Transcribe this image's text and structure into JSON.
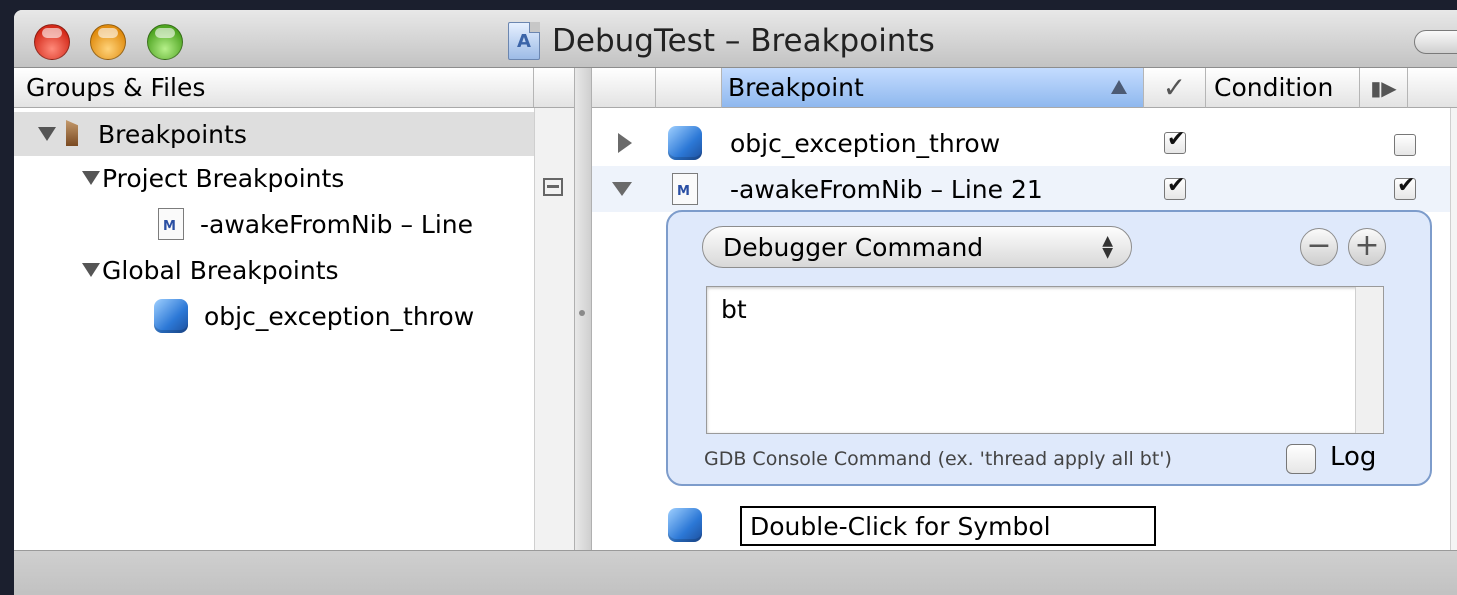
{
  "window": {
    "title": "DebugTest – Breakpoints"
  },
  "left": {
    "header": "Groups & Files",
    "tree": [
      {
        "label": "Breakpoints"
      },
      {
        "label": "Project Breakpoints"
      },
      {
        "label": "-awakeFromNib – Line"
      },
      {
        "label": "Global Breakpoints"
      },
      {
        "label": "objc_exception_throw"
      }
    ]
  },
  "right": {
    "headers": {
      "breakpoint": "Breakpoint",
      "enabled_glyph": "✓",
      "condition": "Condition",
      "continue_glyph": "▮▶"
    },
    "rows": [
      {
        "name": "objc_exception_throw",
        "enabled": true,
        "continue": false
      },
      {
        "name": "-awakeFromNib – Line 21",
        "enabled": true,
        "continue": true
      }
    ],
    "action": {
      "type": "Debugger Command",
      "command": "bt",
      "hint": "GDB Console Command (ex. 'thread apply all bt')",
      "log_label": "Log"
    },
    "new_symbol_placeholder": "Double-Click for Symbol"
  },
  "colors": {
    "selection_blue": "#8fb8ee",
    "panel_blue": "#dfe9fb"
  }
}
